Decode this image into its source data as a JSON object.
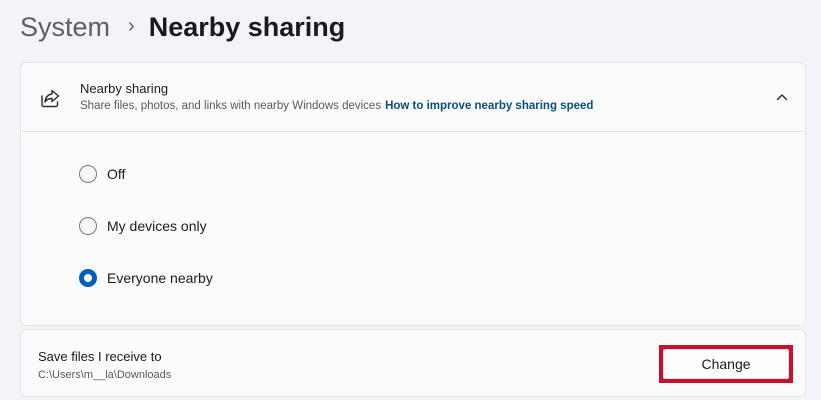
{
  "breadcrumb": {
    "parent": "System",
    "separator": "›",
    "current": "Nearby sharing"
  },
  "nearby_card": {
    "icon": "share-icon",
    "title": "Nearby sharing",
    "subtitle": "Share files, photos, and links with nearby Windows devices",
    "link": "How to improve nearby sharing speed",
    "expanded": true,
    "options": [
      {
        "label": "Off",
        "selected": false
      },
      {
        "label": "My devices only",
        "selected": false
      },
      {
        "label": "Everyone nearby",
        "selected": true
      }
    ]
  },
  "save_card": {
    "title": "Save files I receive to",
    "path": "C:\\Users\\m__la\\Downloads",
    "button": "Change"
  },
  "colors": {
    "accent": "#005fb8",
    "link": "#0a4f7a",
    "highlight_border": "#c8102e",
    "background": "#f3f4f9"
  }
}
